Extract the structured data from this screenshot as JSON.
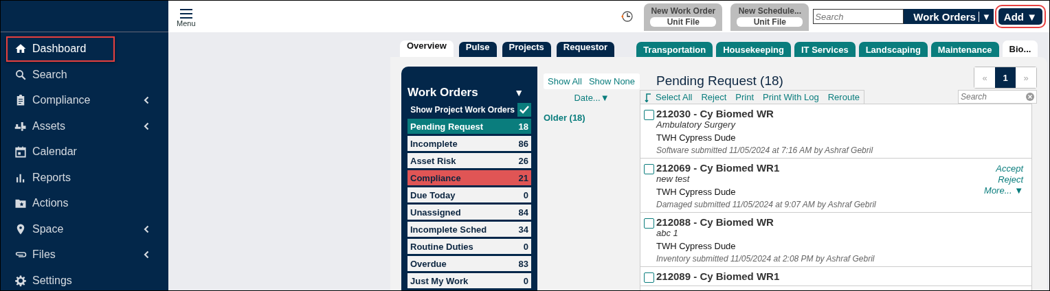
{
  "sidebar": {
    "items": [
      {
        "label": "Dashboard",
        "selected": true,
        "highlighted": true,
        "expandable": false
      },
      {
        "label": "Search",
        "selected": false,
        "highlighted": false,
        "expandable": false
      },
      {
        "label": "Compliance",
        "selected": false,
        "highlighted": false,
        "expandable": true
      },
      {
        "label": "Assets",
        "selected": false,
        "highlighted": false,
        "expandable": true
      },
      {
        "label": "Calendar",
        "selected": false,
        "highlighted": false,
        "expandable": false
      },
      {
        "label": "Reports",
        "selected": false,
        "highlighted": false,
        "expandable": false
      },
      {
        "label": "Actions",
        "selected": false,
        "highlighted": false,
        "expandable": false
      },
      {
        "label": "Space",
        "selected": false,
        "highlighted": false,
        "expandable": true
      },
      {
        "label": "Files",
        "selected": false,
        "highlighted": false,
        "expandable": true
      },
      {
        "label": "Settings",
        "selected": false,
        "highlighted": false,
        "expandable": false
      }
    ]
  },
  "header": {
    "menu_label": "Menu",
    "quick_tabs": [
      {
        "title": "New Work Order",
        "subtitle": "Unit File"
      },
      {
        "title": "New Schedule...",
        "subtitle": "Unit File"
      }
    ],
    "search": {
      "placeholder": "Search"
    },
    "module_select": {
      "value": "Work Orders",
      "caret": "▼"
    },
    "add_button": {
      "label": "Add",
      "caret": "▼",
      "highlighted": true
    }
  },
  "tabs": [
    {
      "label": "Overview",
      "kind": "main",
      "selected": true
    },
    {
      "label": "Pulse",
      "kind": "main",
      "selected": false
    },
    {
      "label": "Projects",
      "kind": "main",
      "selected": false
    },
    {
      "label": "Requestor",
      "kind": "main",
      "selected": false
    },
    {
      "label": "Transportation",
      "kind": "category",
      "selected": false
    },
    {
      "label": "Housekeeping",
      "kind": "category",
      "selected": false
    },
    {
      "label": "IT Services",
      "kind": "category",
      "selected": false
    },
    {
      "label": "Landscaping",
      "kind": "category",
      "selected": false
    },
    {
      "label": "Maintenance",
      "kind": "category",
      "selected": false
    },
    {
      "label": "Bio...",
      "kind": "category",
      "selected": true
    }
  ],
  "work_orders": {
    "title": "Work Orders",
    "caret": "▼",
    "show_project": {
      "label": "Show Project Work Orders",
      "checked": true
    },
    "statuses": [
      {
        "label": "Pending Request",
        "count": "18",
        "selected": true,
        "color": "#0a7d7d"
      },
      {
        "label": "Incomplete",
        "count": "86",
        "selected": false,
        "color": "#f2f2f2"
      },
      {
        "label": "Asset Risk",
        "count": "26",
        "selected": false,
        "color": "#f2f2f2"
      },
      {
        "label": "Compliance",
        "count": "21",
        "selected": false,
        "color": "#e05555"
      },
      {
        "label": "Due Today",
        "count": "0",
        "selected": false,
        "color": "#f2f2f2"
      },
      {
        "label": "Unassigned",
        "count": "84",
        "selected": false,
        "color": "#f2f2f2"
      },
      {
        "label": "Incomplete Sched",
        "count": "34",
        "selected": false,
        "color": "#f2f2f2"
      },
      {
        "label": "Routine Duties",
        "count": "0",
        "selected": false,
        "color": "#f2f2f2"
      },
      {
        "label": "Overdue",
        "count": "83",
        "selected": false,
        "color": "#f2f2f2"
      },
      {
        "label": "Just My Work",
        "count": "0",
        "selected": false,
        "color": "#f2f2f2"
      }
    ]
  },
  "filters": {
    "show_all": "Show All",
    "show_none": "Show None",
    "sort": "Date...",
    "sort_caret": "▼",
    "groups": [
      "Older (18)"
    ]
  },
  "list": {
    "title": "Pending Request (18)",
    "pagination": {
      "prev": "«",
      "pages": [
        {
          "label": "1",
          "selected": true
        }
      ],
      "next": "»"
    },
    "actions": [
      "Select All",
      "Reject",
      "Print",
      "Print With Log",
      "Reroute"
    ],
    "search": {
      "placeholder": "Search"
    },
    "items": [
      {
        "title": "212030 - Cy Biomed WR",
        "subtitle": "Ambulatory Surgery",
        "location": "TWH Cypress Dude",
        "meta": "Software submitted 11/05/2024 at 7:16 AM by Ashraf Gebril",
        "checked": false
      },
      {
        "title": "212069 - Cy Biomed WR1",
        "subtitle": "new test",
        "location": "TWH Cypress Dude",
        "meta": "Damaged submitted 11/05/2024 at 9:07 AM by Ashraf Gebril",
        "checked": false,
        "row_actions": [
          "Accept",
          "Reject",
          "More... ▼"
        ]
      },
      {
        "title": "212088 - Cy Biomed WR",
        "subtitle": "abc 1",
        "location": "TWH Cypress Dude",
        "meta": "Inventory submitted 11/05/2024 at 2:08 PM by Ashraf Gebril",
        "checked": false
      },
      {
        "title": "212089 - Cy Biomed WR1",
        "checked": false
      }
    ]
  }
}
